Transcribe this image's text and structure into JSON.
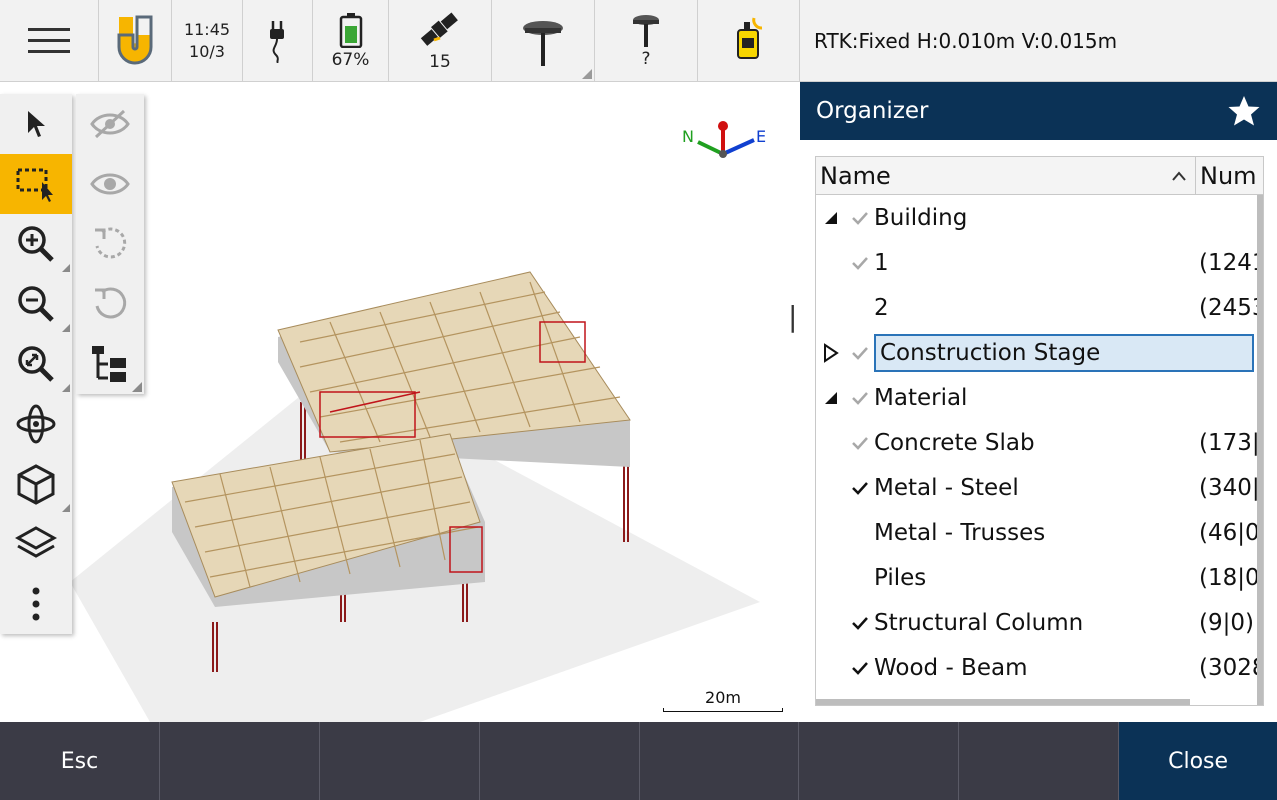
{
  "status_bar": {
    "time": "11:45",
    "date": "10/3",
    "battery_percent": "67%",
    "satellites": "15",
    "receiver_label": "?",
    "rtk_status": "RTK:Fixed H:0.010m V:0.015m",
    "icons": [
      "menu-icon",
      "app-logo-icon",
      "power-plug-icon",
      "battery-icon",
      "satellite-icon",
      "gnss-receiver-icon",
      "gnss-pole-icon",
      "total-station-icon"
    ]
  },
  "map": {
    "scale_label": "20m",
    "compass": {
      "north": "N",
      "east": "E"
    },
    "toolbar": [
      "select-icon",
      "select-box-icon",
      "zoom-in-icon",
      "zoom-out-icon",
      "zoom-extents-icon",
      "orbit-icon",
      "view-cube-icon",
      "layers-icon",
      "more-icon"
    ],
    "toolbar2": [
      "hide-icon",
      "show-icon",
      "undo-rotate-icon",
      "reset-rotate-icon",
      "organizer-tree-icon"
    ]
  },
  "organizer": {
    "title": "Organizer",
    "columns": {
      "name": "Name",
      "num": "Num"
    },
    "rows": [
      {
        "name": "Building",
        "num": "",
        "level": 0,
        "expand": "down",
        "check": "gray"
      },
      {
        "name": "1",
        "num": "(1241",
        "level": 1,
        "expand": "",
        "check": "gray"
      },
      {
        "name": "2",
        "num": "(2453",
        "level": 1,
        "expand": "",
        "check": ""
      },
      {
        "name": "Construction Stage",
        "num": "",
        "level": 0,
        "expand": "right",
        "check": "gray",
        "selected": true
      },
      {
        "name": "Material",
        "num": "",
        "level": 0,
        "expand": "down",
        "check": "gray"
      },
      {
        "name": "Concrete Slab",
        "num": "(173|",
        "level": 1,
        "expand": "",
        "check": "gray"
      },
      {
        "name": "Metal - Steel",
        "num": "(340|",
        "level": 1,
        "expand": "",
        "check": "black"
      },
      {
        "name": "Metal - Trusses",
        "num": "(46|0",
        "level": 1,
        "expand": "",
        "check": ""
      },
      {
        "name": "Piles",
        "num": "(18|0",
        "level": 1,
        "expand": "",
        "check": ""
      },
      {
        "name": "Structural Column",
        "num": "(9|0)",
        "level": 1,
        "expand": "",
        "check": "black"
      },
      {
        "name": "Wood - Beam",
        "num": "(3028",
        "level": 1,
        "expand": "",
        "check": "black"
      }
    ]
  },
  "bottom_bar": {
    "esc_label": "Esc",
    "close_label": "Close"
  },
  "colors": {
    "accent_yellow": "#f7b500",
    "header_navy": "#0b3256",
    "bottom_bar": "#3b3b46"
  }
}
